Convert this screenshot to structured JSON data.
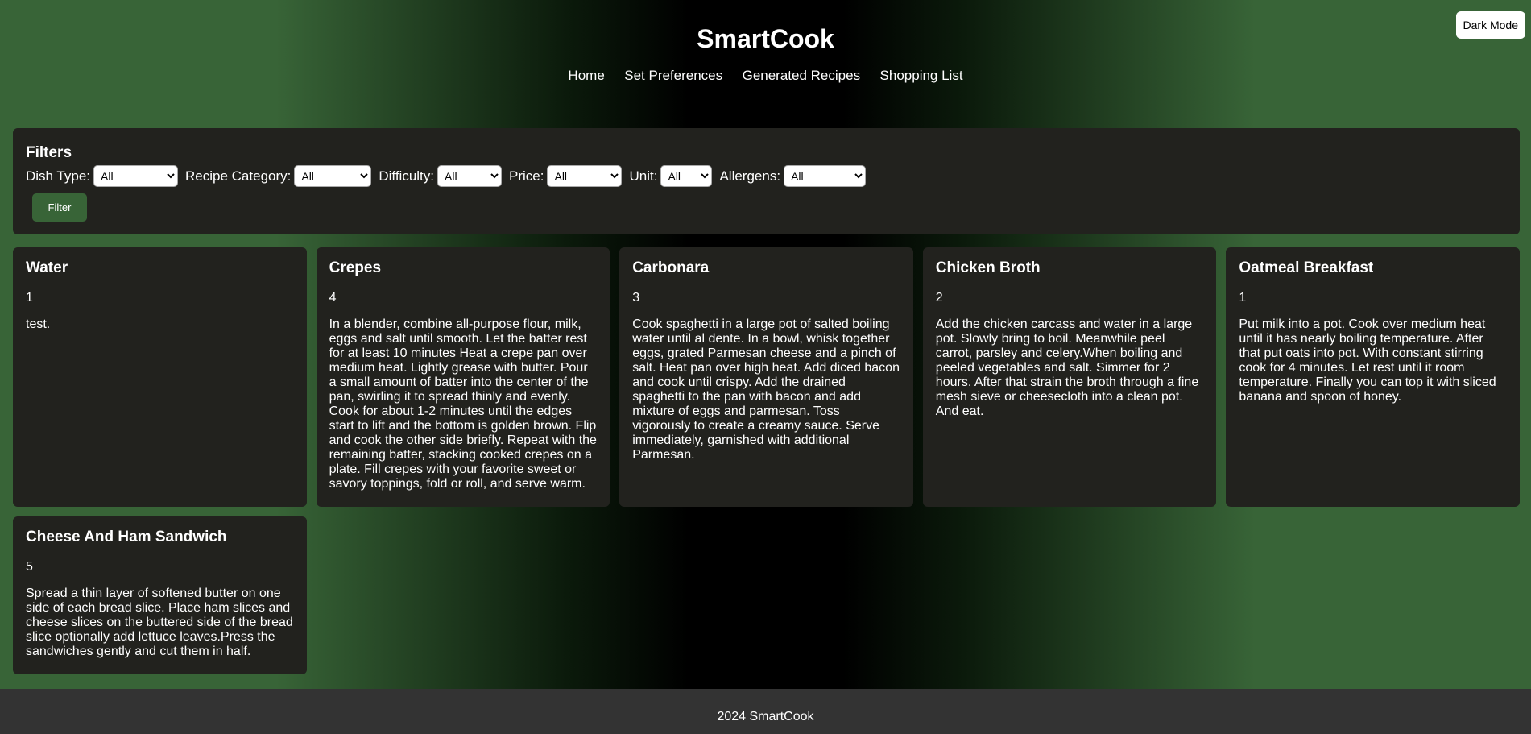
{
  "header": {
    "title": "SmartCook",
    "dark_mode_label": "Dark Mode",
    "nav": [
      "Home",
      "Set Preferences",
      "Generated Recipes",
      "Shopping List"
    ]
  },
  "filters": {
    "title": "Filters",
    "dish_type": {
      "label": "Dish Type:",
      "value": "All"
    },
    "recipe_category": {
      "label": "Recipe Category:",
      "value": "All"
    },
    "difficulty": {
      "label": "Difficulty:",
      "value": "All"
    },
    "price": {
      "label": "Price:",
      "value": "All"
    },
    "unit": {
      "label": "Unit:",
      "value": "All"
    },
    "allergens": {
      "label": "Allergens:",
      "value": "All"
    },
    "button_label": "Filter"
  },
  "recipes": [
    {
      "title": "Water",
      "difficulty": "1",
      "description": "test."
    },
    {
      "title": "Crepes",
      "difficulty": "4",
      "description": "In a blender, combine all-purpose flour, milk, eggs and salt until smooth. Let the batter rest for at least 10 minutes Heat a crepe pan over medium heat. Lightly grease with butter. Pour a small amount of batter into the center of the pan, swirling it to spread thinly and evenly. Cook for about 1-2 minutes until the edges start to lift and the bottom is golden brown. Flip and cook the other side briefly. Repeat with the remaining batter, stacking cooked crepes on a plate. Fill crepes with your favorite sweet or savory toppings, fold or roll, and serve warm."
    },
    {
      "title": "Carbonara",
      "difficulty": "3",
      "description": "Cook spaghetti in a large pot of salted boiling water until al dente. In a bowl, whisk together eggs, grated Parmesan cheese and a pinch of salt. Heat pan over high heat. Add diced bacon and cook until crispy. Add the drained spaghetti to the pan with bacon and add mixture of eggs and parmesan. Toss vigorously to create a creamy sauce. Serve immediately, garnished with additional Parmesan."
    },
    {
      "title": "Chicken Broth",
      "difficulty": "2",
      "description": "Add the chicken carcass and water in a large pot. Slowly bring to boil. Meanwhile peel carrot, parsley and celery.When boiling and peeled vegetables and salt. Simmer for 2 hours. After that strain the broth through a fine mesh sieve or cheesecloth into a clean pot. And eat."
    },
    {
      "title": "Oatmeal Breakfast",
      "difficulty": "1",
      "description": "Put milk into a pot. Cook over medium heat until it has nearly boiling temperature. After that put oats into pot. With constant stirring cook for 4 minutes. Let rest until it room temperature. Finally you can top it with sliced banana and spoon of honey."
    },
    {
      "title": "Cheese And Ham Sandwich",
      "difficulty": "5",
      "description": "Spread a thin layer of softened butter on one side of each bread slice. Place ham slices and cheese slices on the buttered side of the bread slice optionally add lettuce leaves.Press the sandwiches gently and cut them in half."
    }
  ],
  "footer": {
    "text": "2024 SmartCook"
  }
}
